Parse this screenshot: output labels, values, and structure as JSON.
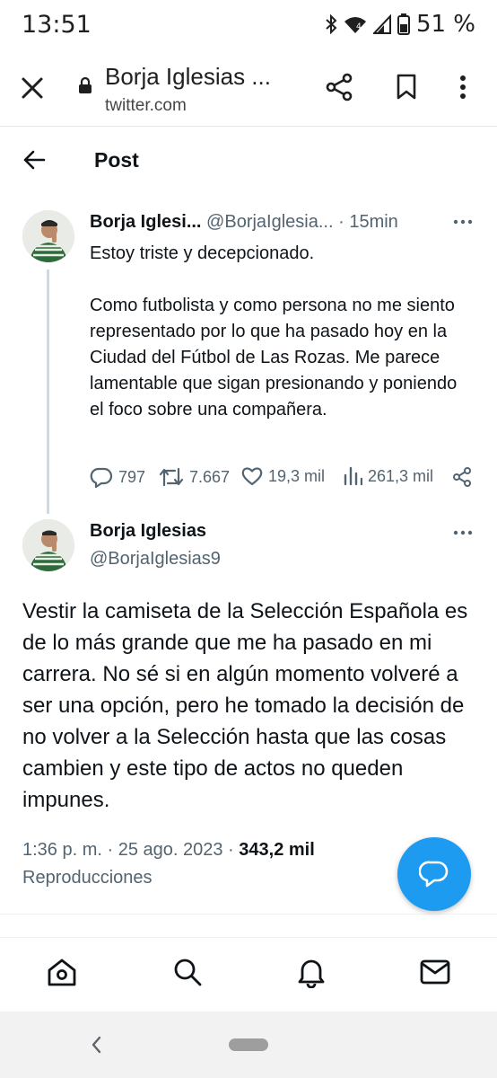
{
  "status_bar": {
    "time": "13:51",
    "battery_percent": "51 %",
    "icons": [
      "bluetooth-icon",
      "wifi-icon",
      "signal-icon",
      "battery-icon"
    ]
  },
  "custom_tab": {
    "title": "Borja Iglesias ...",
    "url": "twitter.com",
    "icons": [
      "close-icon",
      "lock-icon",
      "share-icon",
      "bookmark-icon",
      "more-vert-icon"
    ]
  },
  "header": {
    "title": "Post"
  },
  "reply_tweet": {
    "author_name": "Borja Iglesi...",
    "author_handle": "@BorjaIglesia...",
    "separator": "·",
    "time_ago": "15min",
    "paragraphs": [
      "Estoy triste y decepcionado.",
      "Como futbolista y como persona no me siento representado por lo que ha pasado hoy en la Ciudad del Fútbol de Las Rozas. Me parece lamentable que sigan presionando y poniendo el foco sobre una compañera."
    ],
    "stats": {
      "replies": "797",
      "retweets": "7.667",
      "likes": "19,3 mil",
      "views": "261,3 mil"
    }
  },
  "main_tweet": {
    "author_name": "Borja Iglesias",
    "author_handle": "@BorjaIglesias9",
    "text": "Vestir la camiseta de la Selección Española es de lo más grande que me ha pasado en mi carrera. No sé si en algún momento volveré a ser una opción, pero he tomado la decisión de no volver a la Selección hasta que las cosas cambien y este tipo de actos no queden impunes.",
    "timestamp": "1:36 p. m. · 25 ago. 2023 ·",
    "views_count": "343,2 mil",
    "views_label": "Reproducciones"
  },
  "bottom_nav": {
    "items": [
      "home-icon",
      "search-icon",
      "notifications-icon",
      "messages-icon"
    ]
  },
  "colors": {
    "accent": "#1d9bf0",
    "text": "#0f1419",
    "muted": "#536471"
  }
}
